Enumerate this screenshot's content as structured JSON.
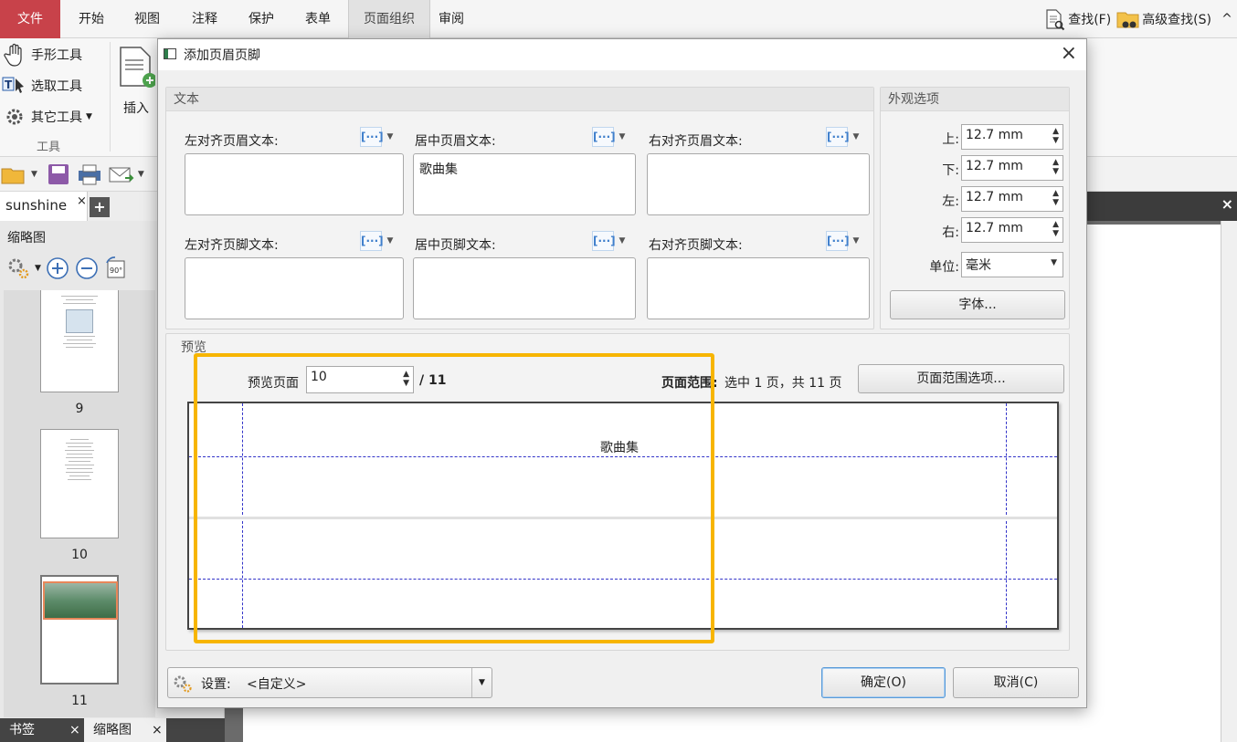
{
  "menu": {
    "file": "文件",
    "items": [
      "开始",
      "视图",
      "注释",
      "保护",
      "表单",
      "页面组织",
      "审阅"
    ],
    "active_index": 5,
    "search": "查找(F)",
    "advanced_search": "高级查找(S)",
    "collapse": "^"
  },
  "ribbon": {
    "hand_tool": "手形工具",
    "select_tool": "选取工具",
    "other_tools": "其它工具",
    "group_tools": "工具",
    "insert": "插入"
  },
  "doc_tab": {
    "name": "sunshine",
    "close": "×",
    "add": "+"
  },
  "right_strip_close": "×",
  "left_panel": {
    "title": "缩略图",
    "rotate_label": "90°",
    "thumbs": [
      {
        "num": "9"
      },
      {
        "num": "10"
      },
      {
        "num": "11"
      }
    ]
  },
  "bottom_tabs": {
    "bookmarks": "书签",
    "thumbnails": "缩略图",
    "close": "×"
  },
  "dialog": {
    "title": "添加页眉页脚",
    "close": "×",
    "text_group": "文本",
    "left_header_label": "左对齐页眉文本:",
    "center_header_label": "居中页眉文本:",
    "right_header_label": "右对齐页眉文本:",
    "left_footer_label": "左对齐页脚文本:",
    "center_footer_label": "居中页脚文本:",
    "right_footer_label": "右对齐页脚文本:",
    "left_header_value": "",
    "center_header_value": "歌曲集",
    "right_header_value": "",
    "left_footer_value": "",
    "center_footer_value": "",
    "right_footer_value": "",
    "insert_macro_glyph": "[···]",
    "appearance_group": "外观选项",
    "top_label": "上:",
    "bottom_label": "下:",
    "left_label": "左:",
    "right_label": "右:",
    "top_value": "12.7 mm",
    "bottom_value": "12.7 mm",
    "left_value": "12.7 mm",
    "right_value": "12.7 mm",
    "unit_label": "单位:",
    "unit_value": "毫米",
    "font_button": "字体...",
    "preview_group": "预览",
    "preview_page_label": "预览页面",
    "preview_page_value": "10",
    "preview_page_total": "/ 11",
    "page_range_label": "页面范围:",
    "page_range_value": "选中 1 页，共 11 页",
    "page_range_button": "页面范围选项...",
    "preview_header_text": "歌曲集",
    "settings_label": "设置:",
    "settings_value": "<自定义>",
    "ok_button": "确定(O)",
    "cancel_button": "取消(C)"
  },
  "colors": {
    "file_tab": "#c8424a",
    "highlight": "#f7b500",
    "guide": "#3233c9"
  }
}
